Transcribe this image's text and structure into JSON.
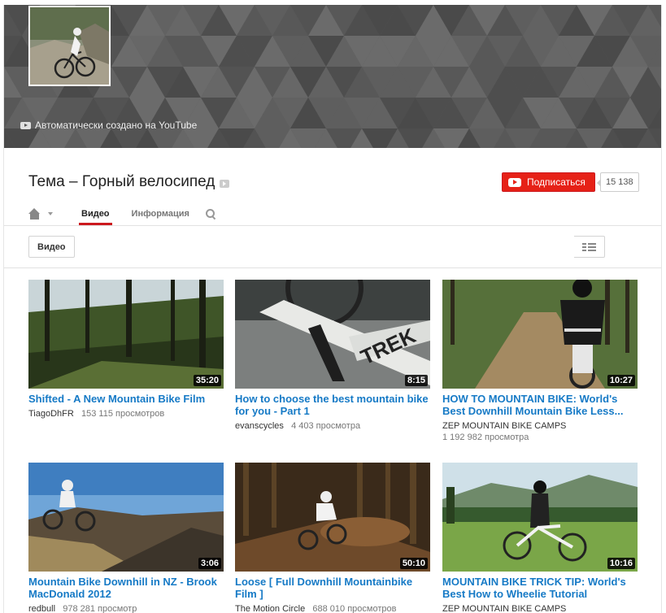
{
  "banner": {
    "auto_created_text": "Автоматически создано на YouTube"
  },
  "channel": {
    "title": "Тема – Горный велосипед",
    "subscribe_label": "Подписаться",
    "subscriber_count": "15 138"
  },
  "tabs": {
    "videos": "Видео",
    "info": "Информация"
  },
  "filter": {
    "label": "Видео"
  },
  "videos": [
    {
      "title": "Shifted - A New Mountain Bike Film",
      "uploader": "TiagoDhFR",
      "views": "153 115 просмотров",
      "duration": "35:20"
    },
    {
      "title": "How to choose the best mountain bike for you - Part 1",
      "uploader": "evanscycles",
      "views": "4 403 просмотра",
      "duration": "8:15"
    },
    {
      "title": "HOW TO MOUNTAIN BIKE: World's Best Downhill Mountain Bike Less...",
      "uploader": "ZEP MOUNTAIN BIKE CAMPS",
      "views": "1 192 982 просмотра",
      "duration": "10:27"
    },
    {
      "title": "Mountain Bike Downhill in NZ - Brook MacDonald 2012",
      "uploader": "redbull",
      "views": "978 281 просмотр",
      "duration": "3:06"
    },
    {
      "title": "Loose [ Full Downhill Mountainbike Film ]",
      "uploader": "The Motion Circle",
      "views": "688 010 просмотров",
      "duration": "50:10"
    },
    {
      "title": "MOUNTAIN BIKE TRICK TIP: World's Best How to Wheelie Tutorial",
      "uploader": "ZEP MOUNTAIN BIKE CAMPS",
      "views": "",
      "duration": "10:16"
    }
  ],
  "colors": {
    "accent_red": "#e62117",
    "link_blue": "#167ac6",
    "banner_gray": "#5a5a5a"
  }
}
